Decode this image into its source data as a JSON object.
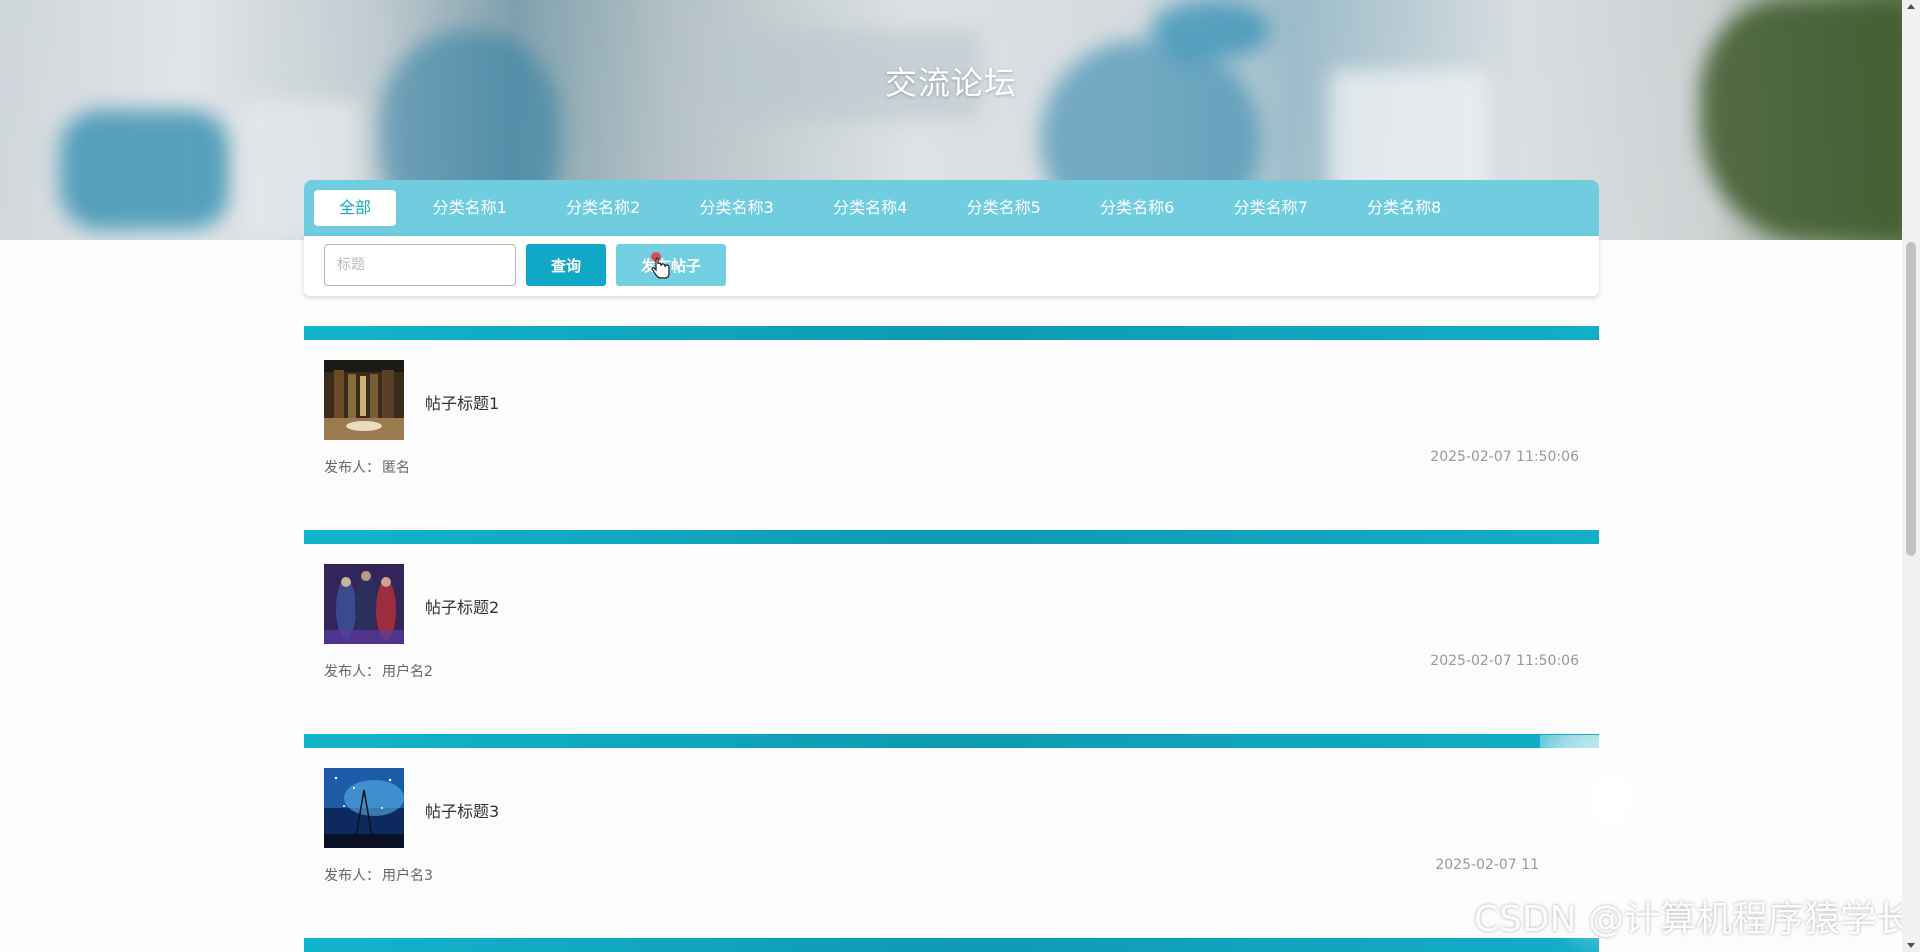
{
  "hero": {
    "title": "交流论坛"
  },
  "categories": [
    {
      "label": "全部",
      "active": true
    },
    {
      "label": "分类名称1"
    },
    {
      "label": "分类名称2"
    },
    {
      "label": "分类名称3"
    },
    {
      "label": "分类名称4"
    },
    {
      "label": "分类名称5"
    },
    {
      "label": "分类名称6"
    },
    {
      "label": "分类名称7"
    },
    {
      "label": "分类名称8"
    }
  ],
  "search": {
    "placeholder": "标题",
    "query_label": "查询",
    "post_label": "发布帖子"
  },
  "posts": [
    {
      "title": "帖子标题1",
      "author_label": "发布人：",
      "author": "匿名",
      "time": "2025-02-07 11:50:06"
    },
    {
      "title": "帖子标题2",
      "author_label": "发布人：",
      "author": "用户名2",
      "time": "2025-02-07 11:50:06"
    },
    {
      "title": "帖子标题3",
      "author_label": "发布人：",
      "author": "用户名3",
      "time": "2025-02-07 11"
    }
  ],
  "watermark": "CSDN @计算机程序猿学长",
  "colors": {
    "accent": "#10a8c6",
    "category_bar": "#70cde0",
    "post_button": "#72cfe2"
  }
}
